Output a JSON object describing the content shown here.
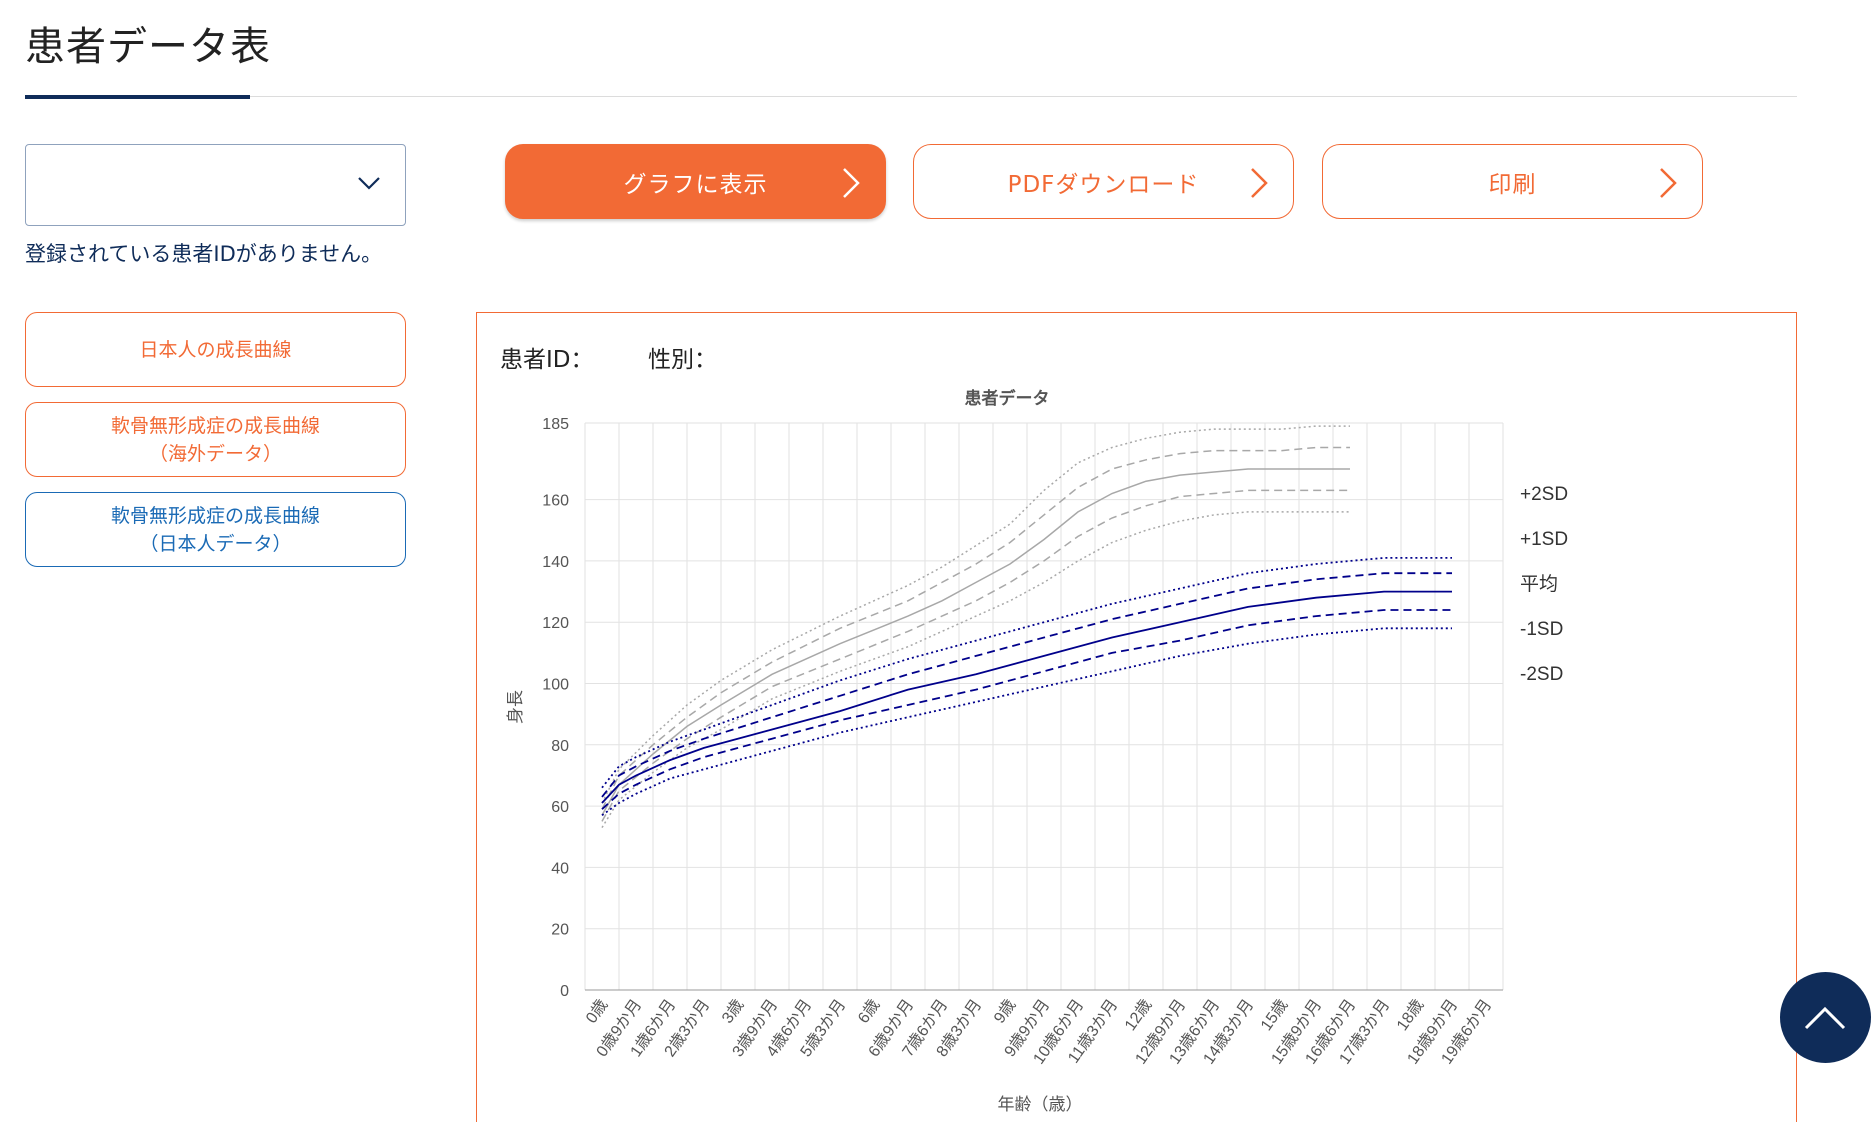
{
  "header": {
    "title": "患者データ表"
  },
  "patient_select": {
    "value": "",
    "notice": "登録されている患者IDがありません。"
  },
  "actions": {
    "graph_label": "グラフに表示",
    "pdf_label": "PDFダウンロード",
    "print_label": "印刷"
  },
  "sidebar": {
    "items": [
      {
        "lines": [
          "日本人の成長曲線"
        ]
      },
      {
        "lines": [
          "軟骨無形成症の成長曲線",
          "（海外データ）"
        ]
      },
      {
        "lines": [
          "軟骨無形成症の成長曲線",
          "（日本人データ）"
        ]
      }
    ]
  },
  "patient_info": {
    "id_label": "患者ID：",
    "sex_label": "性別："
  },
  "colors": {
    "accent": "#f26a35",
    "navy": "#0f2c59",
    "blue_link": "#1a6ab5",
    "series_blue": "#00008b",
    "series_gray": "#a8a8a8"
  },
  "chart_data": {
    "type": "line",
    "title": "患者データ",
    "xlabel": "年齢（歳）",
    "ylabel": "身長",
    "yticks": [
      0,
      20,
      40,
      60,
      80,
      100,
      120,
      140,
      160,
      185
    ],
    "x": [
      "0歳",
      "0歳9か月",
      "1歳6か月",
      "2歳3か月",
      "3歳",
      "3歳9か月",
      "4歳6か月",
      "5歳3か月",
      "6歳",
      "6歳9か月",
      "7歳6か月",
      "8歳3か月",
      "9歳",
      "9歳9か月",
      "10歳6か月",
      "11歳3か月",
      "12歳",
      "12歳9か月",
      "13歳6か月",
      "14歳3か月",
      "15歳",
      "15歳9か月",
      "16歳6か月",
      "17歳3か月",
      "18歳",
      "18歳9か月",
      "19歳6か月"
    ],
    "grid": true,
    "legend": "right",
    "legend_labels": [
      "+2SD",
      "+1SD",
      "平均",
      "-1SD",
      "-2SD"
    ],
    "series": [
      {
        "group": "gray",
        "style": "dotted",
        "points": [
          [
            0,
            61
          ],
          [
            0.5,
            72
          ],
          [
            1.5,
            83
          ],
          [
            2.5,
            93
          ],
          [
            3.5,
            101
          ],
          [
            5,
            111
          ],
          [
            7,
            122
          ],
          [
            9,
            132
          ],
          [
            10,
            138
          ],
          [
            11,
            145
          ],
          [
            12,
            152
          ],
          [
            13,
            163
          ],
          [
            14,
            172
          ],
          [
            15,
            177
          ],
          [
            16,
            180
          ],
          [
            17,
            182
          ],
          [
            18,
            183
          ],
          [
            19,
            183
          ],
          [
            20,
            183
          ],
          [
            21,
            184
          ],
          [
            22,
            184
          ]
        ]
      },
      {
        "group": "gray",
        "style": "dashed",
        "points": [
          [
            0,
            59
          ],
          [
            0.5,
            70
          ],
          [
            1.5,
            80
          ],
          [
            2.5,
            89
          ],
          [
            3.5,
            97
          ],
          [
            5,
            107
          ],
          [
            7,
            118
          ],
          [
            9,
            127
          ],
          [
            10,
            133
          ],
          [
            11,
            139
          ],
          [
            12,
            146
          ],
          [
            13,
            155
          ],
          [
            14,
            164
          ],
          [
            15,
            170
          ],
          [
            16,
            173
          ],
          [
            17,
            175
          ],
          [
            18,
            176
          ],
          [
            19,
            176
          ],
          [
            20,
            176
          ],
          [
            21,
            177
          ],
          [
            22,
            177
          ]
        ]
      },
      {
        "group": "gray",
        "style": "solid",
        "points": [
          [
            0,
            57
          ],
          [
            0.5,
            67
          ],
          [
            1.5,
            77
          ],
          [
            2.5,
            86
          ],
          [
            3.5,
            93
          ],
          [
            5,
            103
          ],
          [
            7,
            113
          ],
          [
            9,
            122
          ],
          [
            10,
            127
          ],
          [
            11,
            133
          ],
          [
            12,
            139
          ],
          [
            13,
            147
          ],
          [
            14,
            156
          ],
          [
            15,
            162
          ],
          [
            16,
            166
          ],
          [
            17,
            168
          ],
          [
            18,
            169
          ],
          [
            19,
            170
          ],
          [
            20,
            170
          ],
          [
            21,
            170
          ],
          [
            22,
            170
          ]
        ]
      },
      {
        "group": "gray",
        "style": "dashed",
        "points": [
          [
            0,
            55
          ],
          [
            0.5,
            65
          ],
          [
            1.5,
            74
          ],
          [
            2.5,
            82
          ],
          [
            3.5,
            89
          ],
          [
            5,
            99
          ],
          [
            7,
            108
          ],
          [
            9,
            117
          ],
          [
            10,
            122
          ],
          [
            11,
            127
          ],
          [
            12,
            133
          ],
          [
            13,
            140
          ],
          [
            14,
            148
          ],
          [
            15,
            154
          ],
          [
            16,
            158
          ],
          [
            17,
            161
          ],
          [
            18,
            162
          ],
          [
            19,
            163
          ],
          [
            20,
            163
          ],
          [
            21,
            163
          ],
          [
            22,
            163
          ]
        ]
      },
      {
        "group": "gray",
        "style": "dotted",
        "points": [
          [
            0,
            53
          ],
          [
            0.5,
            62
          ],
          [
            1.5,
            71
          ],
          [
            2.5,
            79
          ],
          [
            3.5,
            85
          ],
          [
            5,
            95
          ],
          [
            7,
            104
          ],
          [
            9,
            112
          ],
          [
            10,
            117
          ],
          [
            11,
            122
          ],
          [
            12,
            127
          ],
          [
            13,
            133
          ],
          [
            14,
            140
          ],
          [
            15,
            146
          ],
          [
            16,
            150
          ],
          [
            17,
            153
          ],
          [
            18,
            155
          ],
          [
            19,
            156
          ],
          [
            20,
            156
          ],
          [
            21,
            156
          ],
          [
            22,
            156
          ]
        ]
      },
      {
        "group": "blue",
        "style": "dotted",
        "points": [
          [
            0,
            66
          ],
          [
            0.5,
            73
          ],
          [
            1,
            76
          ],
          [
            2,
            81
          ],
          [
            3,
            85
          ],
          [
            5,
            93
          ],
          [
            7,
            101
          ],
          [
            9,
            108
          ],
          [
            11,
            114
          ],
          [
            13,
            120
          ],
          [
            15,
            126
          ],
          [
            17,
            131
          ],
          [
            19,
            136
          ],
          [
            21,
            139
          ],
          [
            23,
            141
          ],
          [
            25,
            141
          ]
        ]
      },
      {
        "group": "blue",
        "style": "dashed",
        "points": [
          [
            0,
            63
          ],
          [
            0.5,
            70
          ],
          [
            1,
            73
          ],
          [
            2,
            78
          ],
          [
            3,
            82
          ],
          [
            5,
            89
          ],
          [
            7,
            96
          ],
          [
            9,
            103
          ],
          [
            11,
            109
          ],
          [
            13,
            115
          ],
          [
            15,
            121
          ],
          [
            17,
            126
          ],
          [
            19,
            131
          ],
          [
            21,
            134
          ],
          [
            23,
            136
          ],
          [
            25,
            136
          ]
        ]
      },
      {
        "group": "blue",
        "style": "solid",
        "points": [
          [
            0,
            61
          ],
          [
            0.5,
            67
          ],
          [
            1,
            70
          ],
          [
            2,
            75
          ],
          [
            3,
            79
          ],
          [
            5,
            85
          ],
          [
            7,
            91
          ],
          [
            9,
            98
          ],
          [
            11,
            103
          ],
          [
            13,
            109
          ],
          [
            15,
            115
          ],
          [
            17,
            120
          ],
          [
            19,
            125
          ],
          [
            21,
            128
          ],
          [
            23,
            130
          ],
          [
            25,
            130
          ]
        ]
      },
      {
        "group": "blue",
        "style": "dashed",
        "points": [
          [
            0,
            59
          ],
          [
            0.5,
            64
          ],
          [
            1,
            67
          ],
          [
            2,
            72
          ],
          [
            3,
            76
          ],
          [
            5,
            82
          ],
          [
            7,
            88
          ],
          [
            9,
            93
          ],
          [
            11,
            98
          ],
          [
            13,
            104
          ],
          [
            15,
            110
          ],
          [
            17,
            114
          ],
          [
            19,
            119
          ],
          [
            21,
            122
          ],
          [
            23,
            124
          ],
          [
            25,
            124
          ]
        ]
      },
      {
        "group": "blue",
        "style": "dotted",
        "points": [
          [
            0,
            57
          ],
          [
            0.5,
            61
          ],
          [
            1,
            64
          ],
          [
            2,
            69
          ],
          [
            3,
            72
          ],
          [
            5,
            78
          ],
          [
            7,
            84
          ],
          [
            9,
            89
          ],
          [
            11,
            94
          ],
          [
            13,
            99
          ],
          [
            15,
            104
          ],
          [
            17,
            109
          ],
          [
            19,
            113
          ],
          [
            21,
            116
          ],
          [
            23,
            118
          ],
          [
            25,
            118
          ]
        ]
      }
    ]
  }
}
